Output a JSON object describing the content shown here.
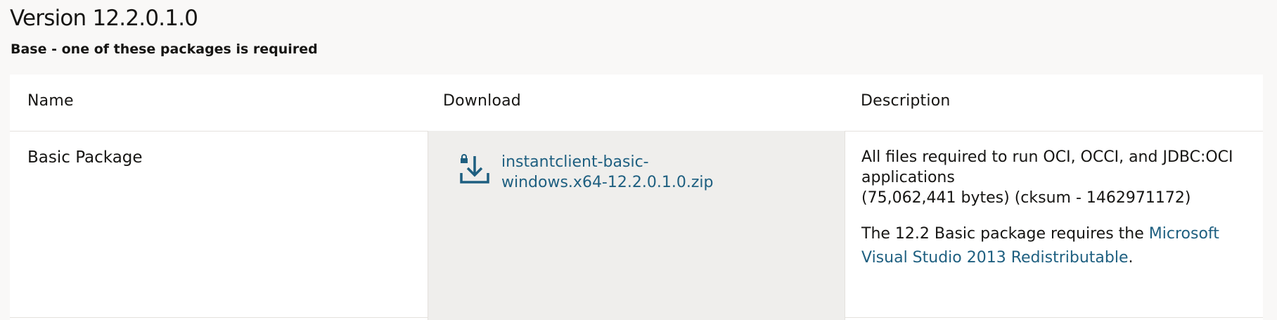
{
  "page": {
    "title": "Version 12.2.0.1.0",
    "subtitle": "Base - one of these packages is required"
  },
  "table": {
    "headers": {
      "name": "Name",
      "download": "Download",
      "description": "Description"
    },
    "rows": [
      {
        "name": "Basic Package",
        "download": {
          "icon": "download-icon",
          "file": "instantclient-basic-windows.x64-12.2.0.1.0.zip"
        },
        "description": {
          "text": "All files required to run OCI, OCCI, and JDBC:OCI applications",
          "size": "(75,062,441 bytes) (cksum - 1462971172)",
          "note_prefix": "The 12.2 Basic package requires the ",
          "note_link": "Microsoft Visual Studio 2013 Redistributable",
          "note_suffix": "."
        }
      }
    ]
  },
  "colors": {
    "link": "#1e5f80",
    "page_background": "#f9f8f7",
    "download_cell_background": "#efeeec"
  }
}
